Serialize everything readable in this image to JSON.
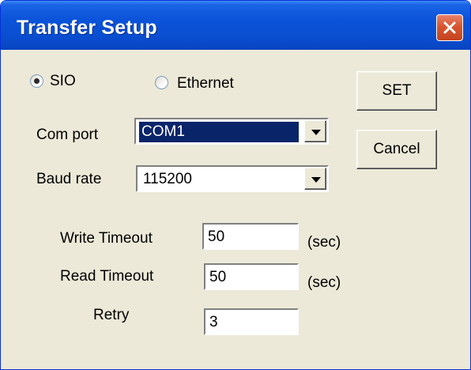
{
  "window": {
    "title": "Transfer Setup"
  },
  "connection": {
    "options": [
      {
        "label": "SIO",
        "selected": true
      },
      {
        "label": "Ethernet",
        "selected": false
      }
    ]
  },
  "com_port": {
    "label": "Com port",
    "value": "COM1"
  },
  "baud_rate": {
    "label": "Baud rate",
    "value": "115200"
  },
  "write_timeout": {
    "label": "Write Timeout",
    "value": "50",
    "unit": "(sec)"
  },
  "read_timeout": {
    "label": "Read Timeout",
    "value": "50",
    "unit": "(sec)"
  },
  "retry": {
    "label": "Retry",
    "value": "3"
  },
  "buttons": {
    "set_label": "SET",
    "cancel_label": "Cancel"
  },
  "colors": {
    "titlebar": "#0a52d8",
    "close": "#d8552e",
    "dialog_bg": "#ece9d8",
    "selection": "#0a246a"
  },
  "icons": {
    "close": "close-icon"
  }
}
